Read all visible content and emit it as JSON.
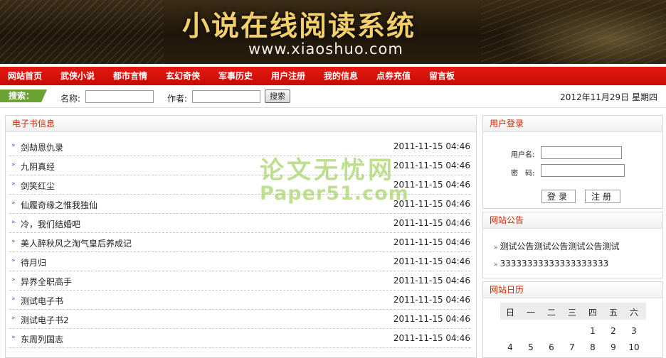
{
  "banner": {
    "title": "小说在线阅读系统",
    "url": "www.xiaoshuo.com"
  },
  "nav": {
    "items": [
      "网站首页",
      "武侠小说",
      "都市言情",
      "玄幻奇侠",
      "军事历史",
      "用户注册",
      "我的信息",
      "点券充值",
      "留言板"
    ]
  },
  "search": {
    "tag": "搜索：",
    "name_label": "名称:",
    "name_value": "",
    "author_label": "作者:",
    "author_value": "",
    "button": "搜索",
    "date": "2012年11月29日 星期四"
  },
  "books": {
    "header": "电子书信息",
    "items": [
      {
        "title": "剑劫恩仇录",
        "time": "2011-11-15 04:46"
      },
      {
        "title": "九阴真经",
        "time": "2011-11-15 04:46"
      },
      {
        "title": "剑笑红尘",
        "time": "2011-11-15 04:46"
      },
      {
        "title": "仙履奇缘之惟我独仙",
        "time": "2011-11-15 04:46"
      },
      {
        "title": "冷，我们结婚吧",
        "time": "2011-11-15 04:46"
      },
      {
        "title": "美人醉秋风之淘气皇后养成记",
        "time": "2011-11-15 04:46"
      },
      {
        "title": "待月归",
        "time": "2011-11-15 04:46"
      },
      {
        "title": "异界全职高手",
        "time": "2011-11-15 04:46"
      },
      {
        "title": "测试电子书",
        "time": "2011-11-15 04:46"
      },
      {
        "title": "测试电子书2",
        "time": "2011-11-15 04:46"
      },
      {
        "title": "东周列国志",
        "time": "2011-11-15 04:46"
      }
    ]
  },
  "login": {
    "header": "用户登录",
    "username_label": "用户名:",
    "password_label": "密　码:",
    "login_button": "登录",
    "register_button": "注册"
  },
  "announcement": {
    "header": "网站公告",
    "items": [
      "测试公告测试公告测试公告测试",
      "33333333333333333333"
    ]
  },
  "calendar": {
    "header": "网站日历",
    "weekdays": [
      "日",
      "一",
      "二",
      "三",
      "四",
      "五",
      "六"
    ],
    "row1": [
      "",
      "",
      "",
      "",
      "1",
      "2",
      "3"
    ],
    "row2": [
      "4",
      "5",
      "6",
      "7",
      "8",
      "9",
      "10"
    ]
  },
  "watermark": {
    "line1": "论文无忧网",
    "line2": "Paper51.com"
  }
}
